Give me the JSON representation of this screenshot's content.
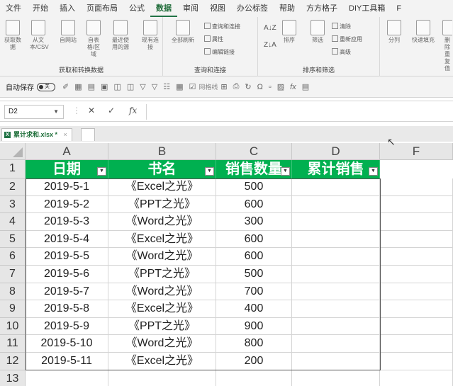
{
  "menu": {
    "tabs": [
      "文件",
      "开始",
      "插入",
      "页面布局",
      "公式",
      "数据",
      "审阅",
      "视图",
      "办公标签",
      "帮助",
      "方方格子",
      "DIY工具箱",
      "F"
    ],
    "active_index": 5
  },
  "ribbon": {
    "group_get": {
      "label": "获取和转换数据",
      "buttons": [
        "获取数据",
        "从文本/CSV",
        "自网站",
        "自表格/区域",
        "最近使用的源",
        "现有连接"
      ]
    },
    "group_query": {
      "label": "查询和连接",
      "refresh_all": "全部刷新",
      "items": [
        "查询和连接",
        "属性",
        "编辑链接"
      ]
    },
    "group_sort": {
      "label": "排序和筛选",
      "sort": "排序",
      "filter": "筛选",
      "items": [
        "清除",
        "重新应用",
        "高级"
      ]
    },
    "group_tools": {
      "buttons": [
        "分列",
        "快速填充",
        "删除重复值"
      ]
    }
  },
  "qat": {
    "autosave_label": "自动保存",
    "autosave_state": "关",
    "gridlines_label": "网格线"
  },
  "formula_bar": {
    "name_box": "D2",
    "cancel": "✕",
    "enter": "✓",
    "fx": "fx",
    "content": ""
  },
  "workbook": {
    "tab_name": "累计求和.xlsx *",
    "icon": "excel-file-icon"
  },
  "sheet": {
    "columns": [
      "A",
      "B",
      "C",
      "D",
      "F"
    ],
    "headers": [
      "日期",
      "书名",
      "销售数量",
      "累计销售"
    ],
    "rows": [
      [
        "2019-5-1",
        "《Excel之光》",
        "500",
        ""
      ],
      [
        "2019-5-2",
        "《PPT之光》",
        "600",
        ""
      ],
      [
        "2019-5-3",
        "《Word之光》",
        "300",
        ""
      ],
      [
        "2019-5-4",
        "《Excel之光》",
        "600",
        ""
      ],
      [
        "2019-5-5",
        "《Word之光》",
        "600",
        ""
      ],
      [
        "2019-5-6",
        "《PPT之光》",
        "500",
        ""
      ],
      [
        "2019-5-7",
        "《Word之光》",
        "700",
        ""
      ],
      [
        "2019-5-8",
        "《Excel之光》",
        "400",
        ""
      ],
      [
        "2019-5-9",
        "《PPT之光》",
        "900",
        ""
      ],
      [
        "2019-5-10",
        "《Word之光》",
        "800",
        ""
      ],
      [
        "2019-5-11",
        "《Excel之光》",
        "200",
        ""
      ]
    ],
    "row_numbers": [
      "1",
      "2",
      "3",
      "4",
      "5",
      "6",
      "7",
      "8",
      "9",
      "10",
      "11",
      "12",
      "13"
    ],
    "header_color": "#00b050"
  }
}
